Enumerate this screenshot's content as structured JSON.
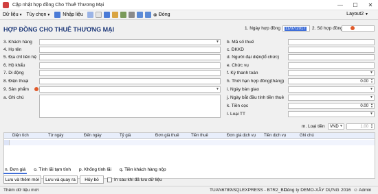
{
  "window": {
    "title": "Cập nhật hợp đồng Cho Thuê Thương Mại",
    "minimize": "—",
    "maximize": "☐",
    "close": "✕"
  },
  "menu": {
    "items": [
      "Dữ liệu",
      "Tùy chọn",
      "Nhập liệu"
    ],
    "close_label": "Đóng",
    "layout_label": "Layout2"
  },
  "form": {
    "title": "HỢP ĐỒNG CHO THUÊ THƯƠNG MẠI",
    "contract_date_label": "1. Ngày hợp đồng",
    "contract_date_value": "11/07/2017",
    "contract_no_label": "2. Số hợp đồng",
    "left_fields": [
      "3. Khách hàng",
      "4. Họ tên",
      "5. Địa chỉ liên hệ",
      "6. Hộ khẩu",
      "7. Di động",
      "8. Điện thoại",
      "9. Sản phẩm",
      "a. Ghi chú"
    ],
    "right_fields": [
      {
        "label": "b. Mã số thuế",
        "value": ""
      },
      {
        "label": "c. ĐKKD",
        "value": ""
      },
      {
        "label": "d. Người đại diện(tổ chức)",
        "value": ""
      },
      {
        "label": "e. Chức vụ",
        "value": ""
      },
      {
        "label": "f. Kỳ thanh toán",
        "value": ""
      },
      {
        "label": "h. Thời hạn hợp đồng(tháng)",
        "value": "0.00"
      },
      {
        "label": "i. Ngày bàn giao",
        "value": ""
      },
      {
        "label": "j. Ngày bắt đầu tính tiền thuê",
        "value": ""
      },
      {
        "label": "k. Tiền cọc",
        "value": "0.00"
      },
      {
        "label": "l. Loại TT",
        "value": ""
      }
    ],
    "currency_label": "m. Loại tiền",
    "currency_value": "VND",
    "rate_value": "1.00"
  },
  "grid": {
    "columns": [
      "Diện tích",
      "Từ ngày",
      "Đến ngày",
      "Tỷ giá",
      "Đơn giá thuê",
      "Tiền thuê",
      "Đơn giá dịch vụ",
      "Tiền dịch vụ",
      "Ghi chú"
    ]
  },
  "tabs": [
    "n. Đơn giá",
    "o. Tính lãi tạm tính",
    "p. Khống tính lãi",
    "q. Tiền khách hàng nộp"
  ],
  "buttons": {
    "save_new": "Lưu và thêm mới",
    "save_back": "Lưu và quay ra",
    "cancel": "Hủy bỏ",
    "print_after_save": "In sau khi đã lưu dữ liệu"
  },
  "status": {
    "message": "Thêm dữ liệu mới",
    "server": "TUAN6789\\SQLEXPRESS - B7R2_BD...",
    "company": "Công ty DEMO-XÂY DỰNG",
    "year": "2016",
    "user": "Admin"
  },
  "colors": {
    "title_blue": "#1f3a7a",
    "accent": "#3f6ed8",
    "required_dot": "#e05a2a"
  }
}
